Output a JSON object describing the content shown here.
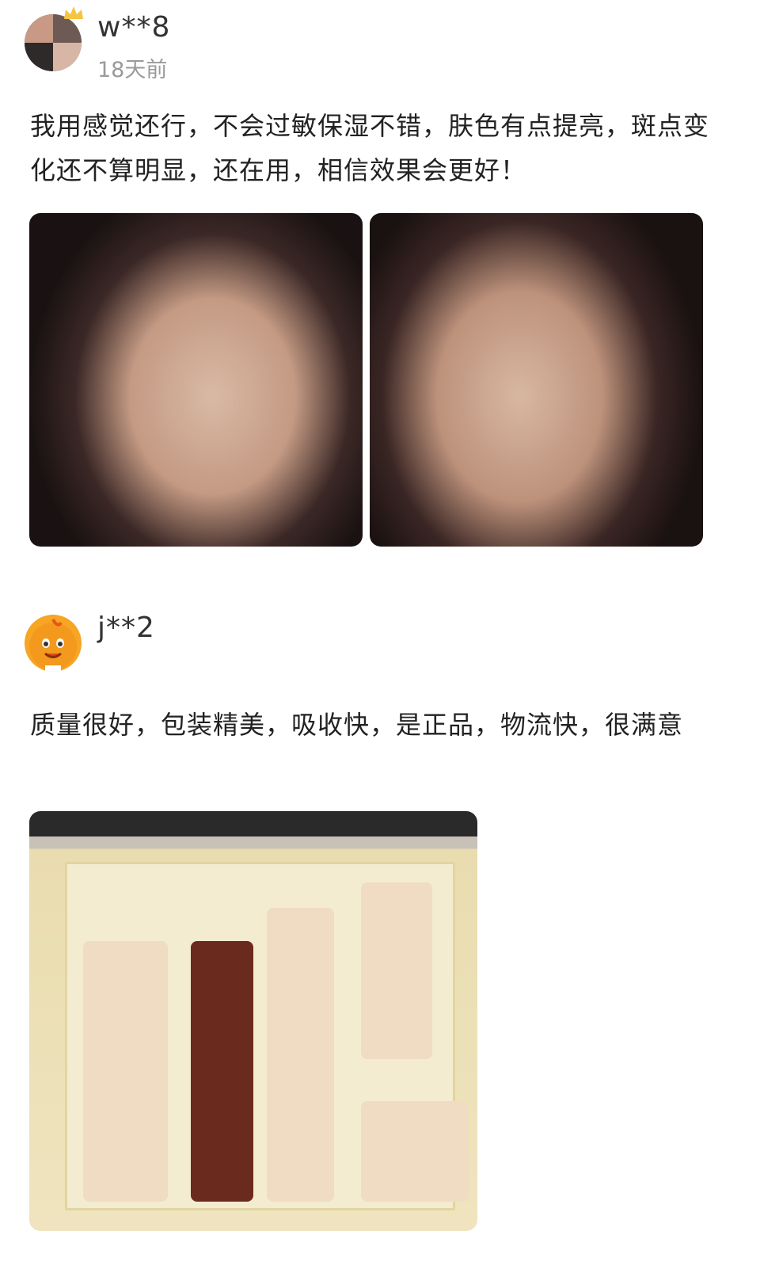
{
  "reviews": [
    {
      "username": "w**8",
      "timestamp": "18天前",
      "text": "我用感觉还行，不会过敏保湿不错，肤色有点提亮，斑点变化还不算明显，还在用，相信效果会更好！",
      "avatar_icon": "collage-avatar-with-crown-icon",
      "photo_count": 2
    },
    {
      "username": "j**2",
      "text": "质量很好，包装精美，吸收快，是正品，物流快，很满意",
      "avatar_icon": "orange-mascot-avatar-icon",
      "photo_count": 1
    }
  ],
  "colors": {
    "text": "#222222",
    "username": "#333333",
    "timestamp": "#9a9a9a",
    "background": "#ffffff"
  }
}
